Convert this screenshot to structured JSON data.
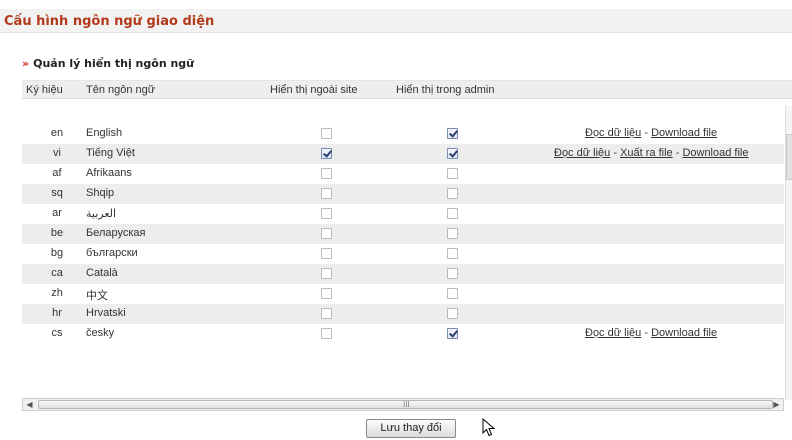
{
  "page_title": "Cấu hình ngôn ngữ giao diện",
  "section_heading": "Quản lý hiển thị ngôn ngữ",
  "section_marker": "»",
  "columns": {
    "code": "Ký hiệu",
    "name": "Tên ngôn ngữ",
    "site": "Hiển thị ngoài site",
    "admin": "Hiển thị trong admin"
  },
  "links": {
    "read": "Đọc dữ liệu",
    "export": "Xuất ra file",
    "download": "Download file",
    "separator": " - "
  },
  "rows": [
    {
      "code": "en",
      "name": "English",
      "site": false,
      "admin": true,
      "links": [
        "read",
        "download"
      ]
    },
    {
      "code": "vi",
      "name": "Tiếng Việt",
      "site": true,
      "admin": true,
      "links": [
        "read",
        "export",
        "download"
      ]
    },
    {
      "code": "af",
      "name": "Afrikaans",
      "site": false,
      "admin": false,
      "links": []
    },
    {
      "code": "sq",
      "name": "Shqip",
      "site": false,
      "admin": false,
      "links": []
    },
    {
      "code": "ar",
      "name": "العربية",
      "site": false,
      "admin": false,
      "links": []
    },
    {
      "code": "be",
      "name": "Беларуская",
      "site": false,
      "admin": false,
      "links": []
    },
    {
      "code": "bg",
      "name": "български",
      "site": false,
      "admin": false,
      "links": []
    },
    {
      "code": "ca",
      "name": "Català",
      "site": false,
      "admin": false,
      "links": []
    },
    {
      "code": "zh",
      "name": "中文",
      "site": false,
      "admin": false,
      "links": []
    },
    {
      "code": "hr",
      "name": "Hrvatski",
      "site": false,
      "admin": false,
      "links": []
    },
    {
      "code": "cs",
      "name": "česky",
      "site": false,
      "admin": true,
      "links": [
        "read",
        "download"
      ]
    }
  ],
  "save_button": "Lưu thay đổi",
  "scrollbar_grip": "III",
  "colors": {
    "title": "#b23a1a",
    "marker": "#d0281c",
    "alt_row": "#ededed"
  },
  "icons": [
    "chevron-left-icon",
    "chevron-right-icon",
    "mouse-pointer-icon"
  ]
}
